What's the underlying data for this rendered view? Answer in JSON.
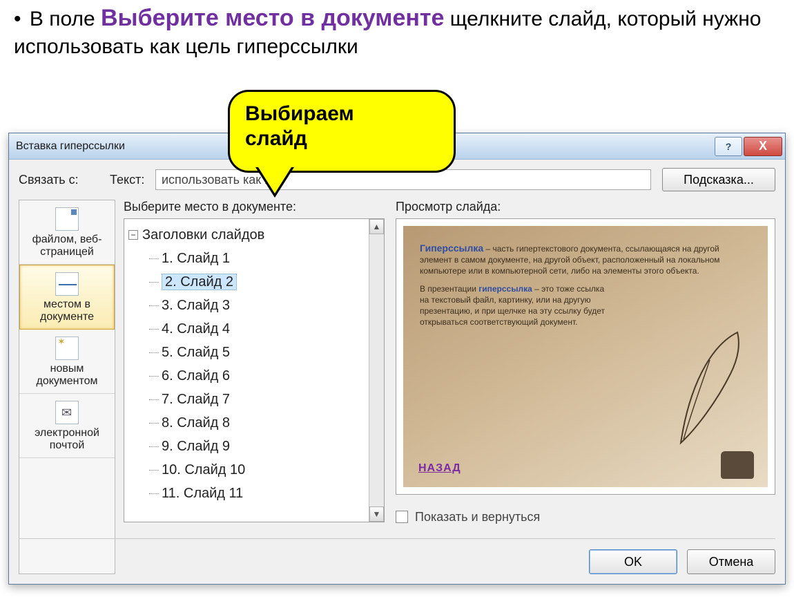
{
  "instruction": {
    "prefix": "В поле ",
    "highlight": "Выберите место в документе",
    "suffix": " щелкните слайд, который нужно использовать как цель гиперссылки"
  },
  "callout": {
    "line1": "Выбираем",
    "line2": "слайд"
  },
  "dialog": {
    "title": "Вставка гиперссылки",
    "help_symbol": "?",
    "close_symbol": "X",
    "link_with_label": "Связать с:",
    "text_label": "Текст:",
    "text_value": "использовать как гип",
    "hint_button": "Подсказка...",
    "nav": [
      {
        "label": "файлом, веб-страницей",
        "icon": "doc",
        "active": false
      },
      {
        "label": "местом в документе",
        "icon": "place",
        "active": true
      },
      {
        "label": "новым документом",
        "icon": "newd",
        "active": false
      },
      {
        "label": "электронной почтой",
        "icon": "mail",
        "active": false
      }
    ],
    "tree_label": "Выберите место в документе:",
    "tree": {
      "root": "Заголовки слайдов",
      "expand_symbol": "−",
      "items": [
        "1. Слайд 1",
        "2. Слайд 2",
        "3. Слайд 3",
        "4. Слайд 4",
        "5. Слайд 5",
        "6. Слайд 6",
        "7. Слайд 7",
        "8. Слайд 8",
        "9. Слайд 9",
        "10. Слайд 10",
        "11. Слайд 11"
      ],
      "selected_index": 1,
      "scroll_up": "▲",
      "scroll_down": "▼"
    },
    "preview_label": "Просмотр слайда:",
    "preview": {
      "p1_head": "Гиперссылка",
      "p1_body": " – часть гипертекстового документа, ссылающаяся на другой элемент в самом документе, на другой объект, расположенный на локальном компьютере или в компьютерной сети, либо на элементы этого объекта.",
      "p2_pre": "В презентации ",
      "p2_head": "гиперссылка",
      "p2_body": " – это тоже ссылка на текстовый файл, картинку, или на другую презентацию, и при щелчке на эту ссылку будет открываться соответствующий документ.",
      "back": "НАЗАД"
    },
    "checkbox_label": "Показать и вернуться",
    "ok": "OK",
    "cancel": "Отмена"
  }
}
